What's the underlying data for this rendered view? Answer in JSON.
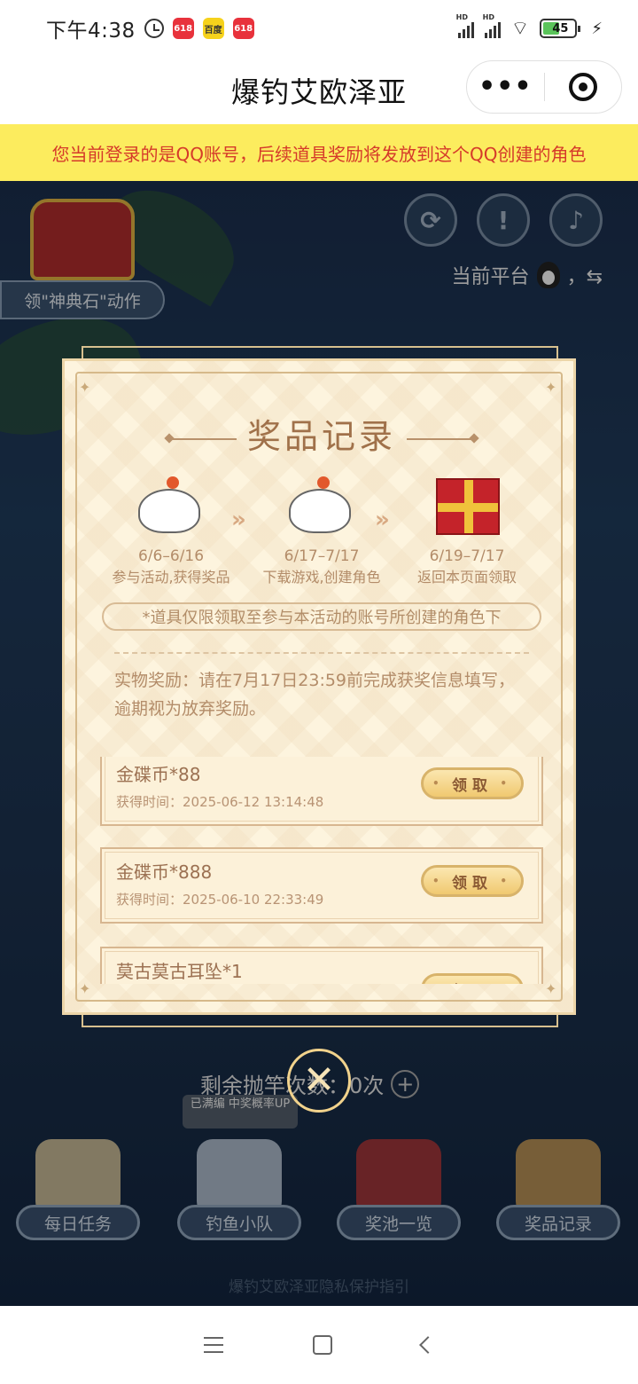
{
  "status_bar": {
    "time": "下午4:38",
    "battery": "45",
    "app_icon_1": "618",
    "app_icon_2": "百度",
    "app_icon_3": "618",
    "hd": "HD"
  },
  "title_bar": {
    "title": "爆钓艾欧泽亚",
    "more_glyph": "•••"
  },
  "notice": "您当前登录的是QQ账号，后续道具奖励将发放到这个QQ创建的角色",
  "game": {
    "chest_label": "领\"神典石\"动作",
    "platform_label": "当前平台",
    "platform_suffix": "，⇆",
    "remaining_label": "剩余抛竿次数：0次",
    "full_team_badge": "已满编 中奖概率UP",
    "nav": [
      "每日任务",
      "钓鱼小队",
      "奖池一览",
      "奖品记录"
    ],
    "privacy": "爆钓艾欧泽亚隐私保护指引"
  },
  "modal": {
    "title": "奖品记录",
    "steps": [
      {
        "date": "6/6–6/16",
        "text": "参与活动,获得奖品"
      },
      {
        "date": "6/17–7/17",
        "text": "下载游戏,创建角色"
      },
      {
        "date": "6/19–7/17",
        "text": "返回本页面领取"
      }
    ],
    "limit_note": "*道具仅限领取至参与本活动的账号所创建的角色下",
    "real_note": "实物奖励：请在7月17日23:59前完成获奖信息填写，逾期视为放弃奖励。",
    "claim_label": "领取",
    "items": [
      {
        "name": "金碟币*88",
        "time": "获得时间：2025-06-12 13:14:48"
      },
      {
        "name": "金碟币*888",
        "time": "获得时间：2025-06-10 22:33:49"
      },
      {
        "name": "莫古莫古耳坠*1",
        "time": ""
      }
    ]
  },
  "colors": {
    "notice_bg": "#fcec5e",
    "notice_text": "#d53a2a",
    "modal_bg": "#fdf4de",
    "accent": "#a0714a"
  }
}
